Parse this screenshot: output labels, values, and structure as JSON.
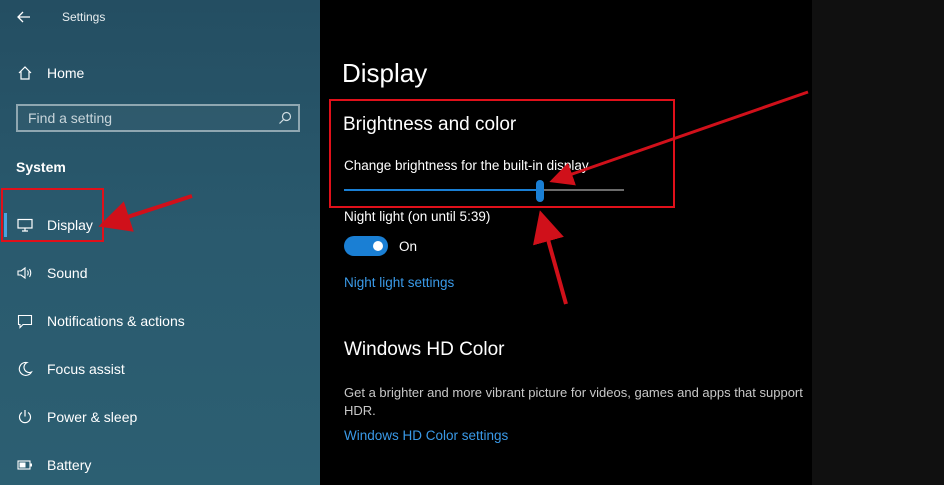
{
  "window": {
    "title": "Settings"
  },
  "sidebar": {
    "home_label": "Home",
    "search_placeholder": "Find a setting",
    "section_heading": "System",
    "items": [
      {
        "label": "Display",
        "icon": "monitor-icon",
        "selected": true
      },
      {
        "label": "Sound",
        "icon": "speaker-icon"
      },
      {
        "label": "Notifications & actions",
        "icon": "message-icon"
      },
      {
        "label": "Focus assist",
        "icon": "moon-icon"
      },
      {
        "label": "Power & sleep",
        "icon": "power-icon"
      },
      {
        "label": "Battery",
        "icon": "battery-icon"
      }
    ]
  },
  "main": {
    "page_title": "Display",
    "brightness": {
      "heading": "Brightness and color",
      "slider_label": "Change brightness for the built-in display",
      "value_percent": 70
    },
    "night_light": {
      "label": "Night light (on until 5:39)",
      "state": "On",
      "enabled": true,
      "settings_link": "Night light settings"
    },
    "hd_color": {
      "heading": "Windows HD Color",
      "description": "Get a brighter and more vibrant picture for videos, games and apps that support HDR.",
      "settings_link": "Windows HD Color settings"
    }
  },
  "colors": {
    "accent": "#1a7fd4",
    "link": "#3a9ae8",
    "annotation": "#e0101a",
    "sidebar_bg": "#2a5a6e"
  }
}
